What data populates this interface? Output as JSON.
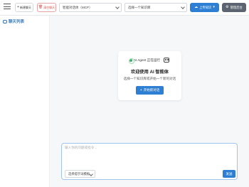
{
  "header": {
    "new_chat_label": "新建聊天",
    "clear_chat_label": "清空聊天",
    "mode_select_value": "智能对话体（MCP）",
    "kb_select_value": "选择一个知识库",
    "upload_label": "上传知识",
    "admin_label": "管理后台"
  },
  "sidebar": {
    "title": "聊天列表"
  },
  "welcome": {
    "status_text": "AI Agent 正在运行",
    "title": "欢迎使用 AI 智能体",
    "subtitle": "选择一个知识库或开始一个新的对话",
    "start_label": "开始新对话"
  },
  "composer": {
    "placeholder": "输入你的问题或指令...",
    "model_select_value": "选择提示词模板",
    "send_label": "发送"
  },
  "colors": {
    "primary": "#2d7fd3",
    "danger": "#d9534f",
    "admin": "#5b6470",
    "status_green": "#3cb371"
  }
}
